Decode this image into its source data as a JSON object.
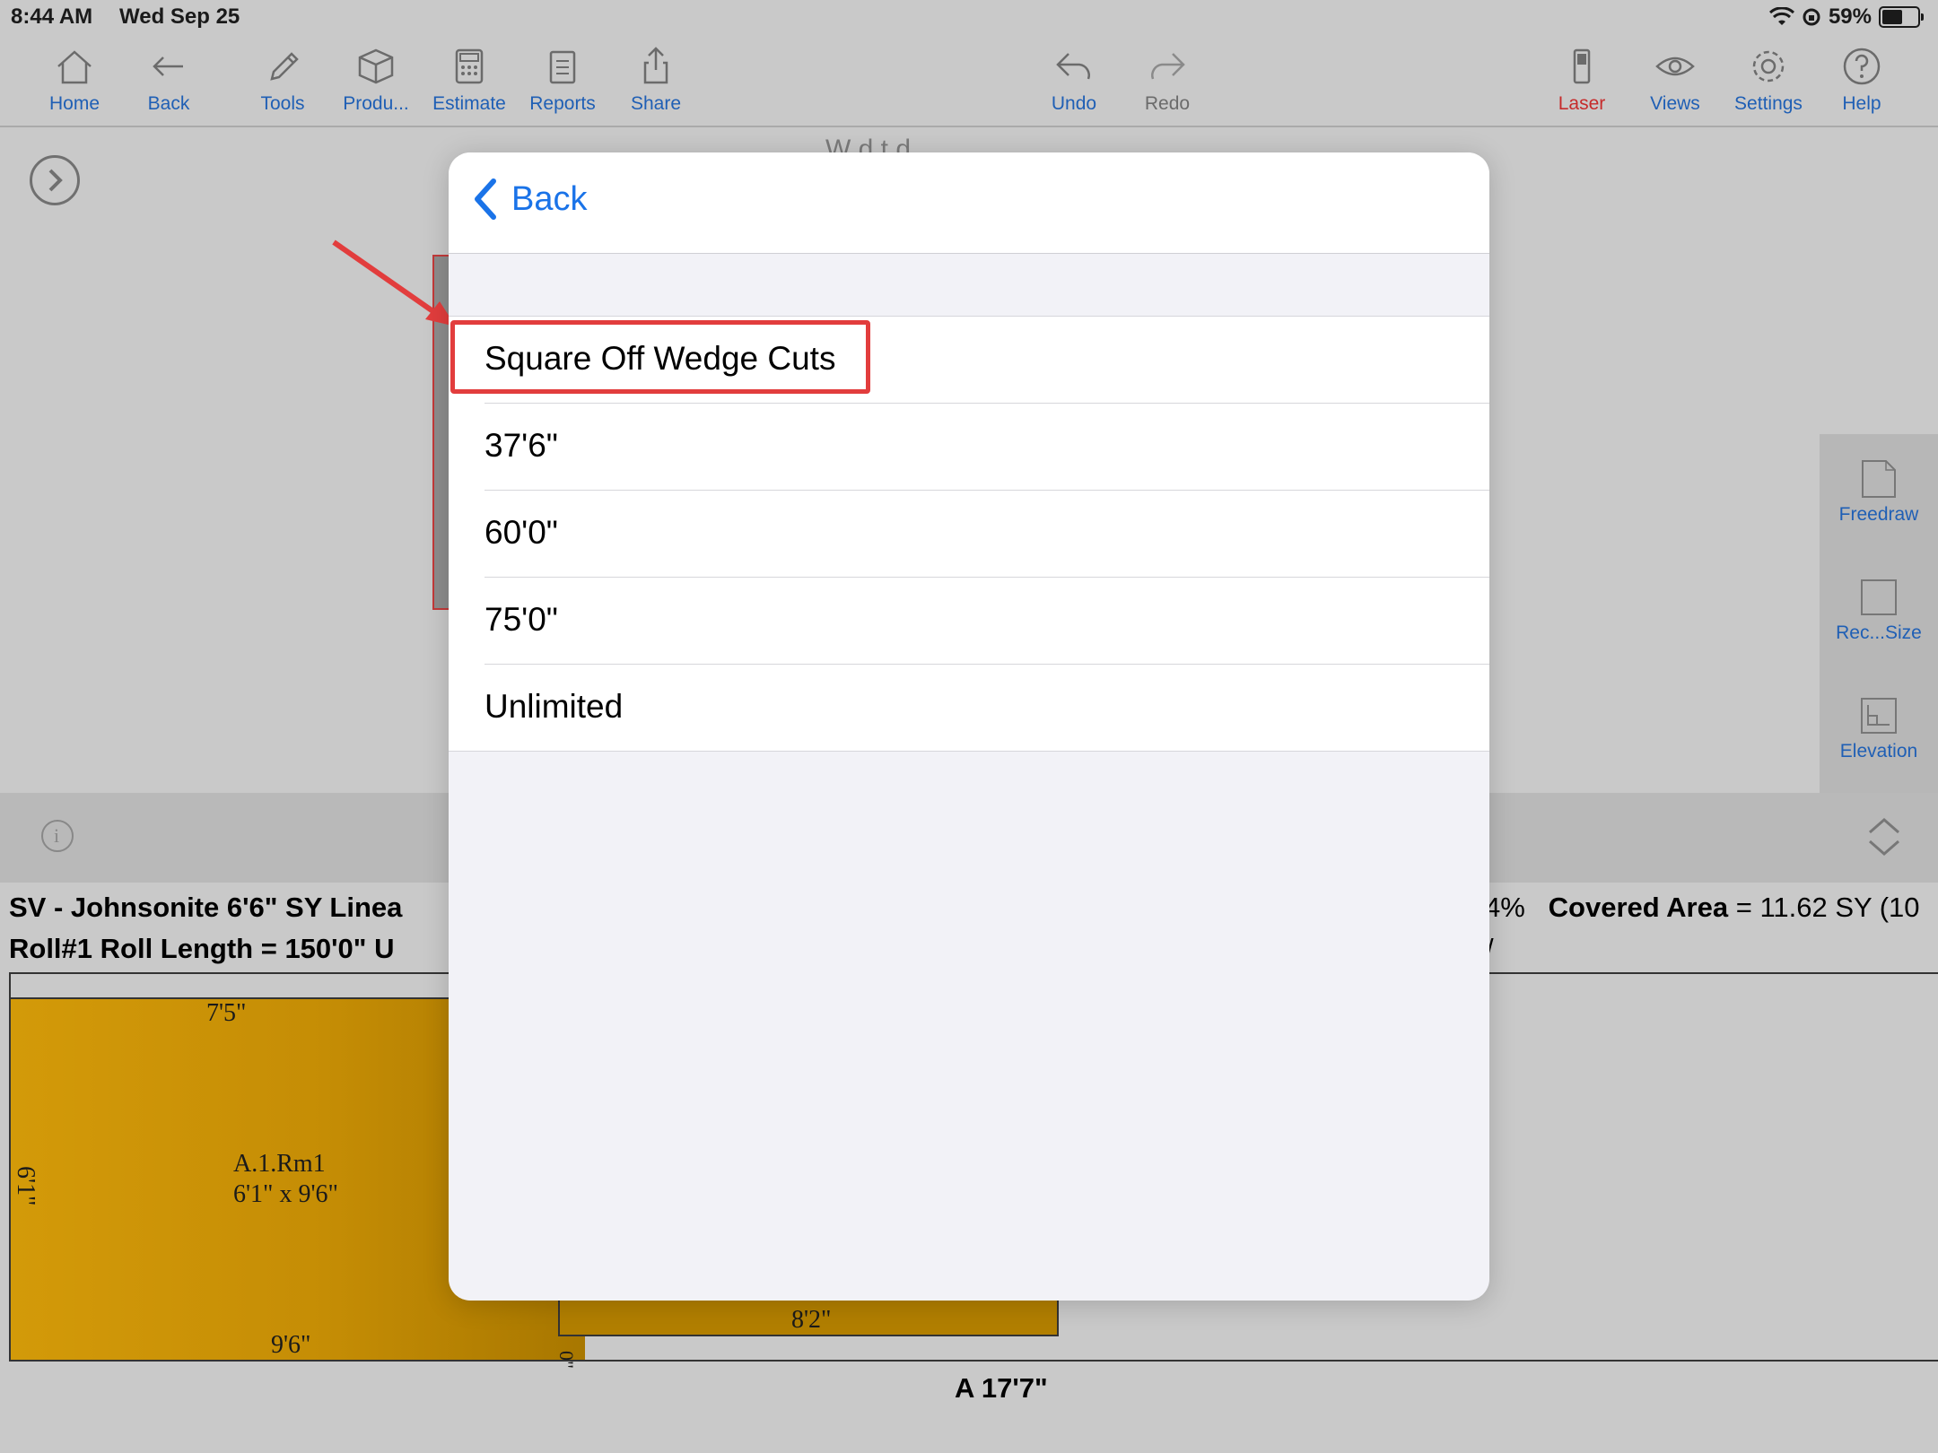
{
  "status": {
    "time": "8:44 AM",
    "date": "Wed Sep 25",
    "battery": "59%",
    "battery_level": 0.59
  },
  "toolbar": {
    "home": "Home",
    "back": "Back",
    "tools": "Tools",
    "products": "Produ...",
    "estimate": "Estimate",
    "reports": "Reports",
    "share": "Share",
    "undo": "Undo",
    "redo": "Redo",
    "laser": "Laser",
    "views": "Views",
    "settings": "Settings",
    "help": "Help"
  },
  "canvas": {
    "title_partial": "W   d         t    d"
  },
  "palette": {
    "freedraw": "Freedraw",
    "rect_size": "Rec...Size",
    "elevation": "Elevation"
  },
  "summary": {
    "line1": "SV - Johnsonite 6'6\" SY   Linea",
    "line2": "Roll#1   Roll Length = 150'0\"   U",
    "right_pct": "4%",
    "covered_label": "Covered Area",
    "covered_value": " = 11.62 SY (10",
    "right_line2": "/"
  },
  "roll": {
    "top_dim": "7'5\"",
    "side_dim": "6'1\"",
    "room_name": "A.1.Rm1",
    "room_size": "6'1\" x 9'6\"",
    "bottom_dim": "9'6\"",
    "piece_b_dim": "8'2\"",
    "small_dim": "0\"",
    "total": "A 17'7\""
  },
  "modal": {
    "back_label": "Back",
    "options": [
      {
        "label": "Square Off Wedge Cuts"
      },
      {
        "label": "37'6\""
      },
      {
        "label": "60'0\""
      },
      {
        "label": "75'0\""
      },
      {
        "label": "Unlimited"
      }
    ]
  },
  "colors": {
    "accent": "#1a73e8",
    "toolbar_blue": "#1f5fb5",
    "laser_red": "#c62b2b",
    "highlight_red": "#e23d3d",
    "roll_fill": "#d39a09"
  }
}
